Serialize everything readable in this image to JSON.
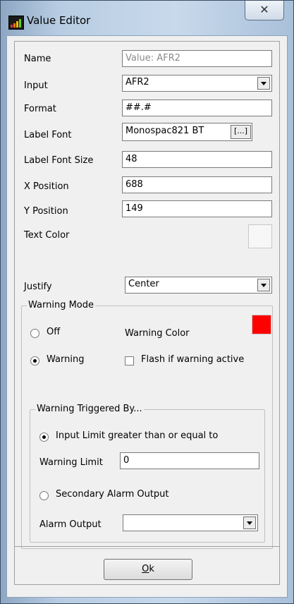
{
  "window": {
    "title": "Value Editor",
    "close_glyph": "✕"
  },
  "form": {
    "name_label": "Name",
    "name_value": "Value: AFR2",
    "input_label": "Input",
    "input_value": "AFR2",
    "format_label": "Format",
    "format_value": "##.#",
    "label_font_label": "Label Font",
    "label_font_value": "Monospac821 BT",
    "browse_label": "[...]",
    "label_font_size_label": "Label Font Size",
    "label_font_size_value": "48",
    "x_position_label": "X Position",
    "x_position_value": "688",
    "y_position_label": "Y Position",
    "y_position_value": "149",
    "text_color_label": "Text Color",
    "text_color": "#f7f7f7",
    "justify_label": "Justify",
    "justify_value": "Center"
  },
  "warning_mode": {
    "title": "Warning Mode",
    "off_label": "Off",
    "warning_label": "Warning",
    "selected": "warning",
    "warning_color_label": "Warning Color",
    "warning_color": "#ff0000",
    "flash_label": "Flash if warning active",
    "flash_checked": false
  },
  "triggered_by": {
    "title": "Warning Triggered By...",
    "input_limit_label": "Input Limit greater than or equal to",
    "warning_limit_label": "Warning Limit",
    "warning_limit_value": "0",
    "secondary_label": "Secondary Alarm Output",
    "alarm_output_label": "Alarm Output",
    "alarm_output_value": "",
    "selected": "input_limit"
  },
  "footer": {
    "ok_label_first": "O",
    "ok_label_rest": "k"
  }
}
